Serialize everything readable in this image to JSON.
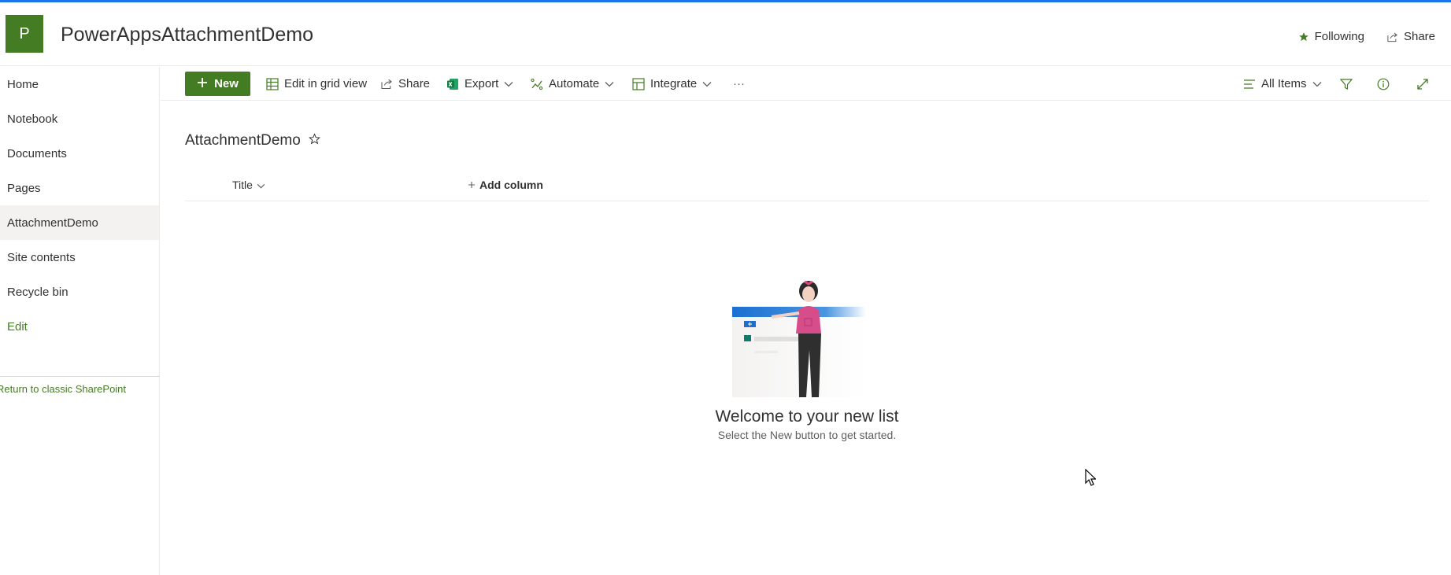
{
  "site": {
    "logo_letter": "P",
    "title": "PowerAppsAttachmentDemo",
    "following_label": "Following",
    "share_label": "Share"
  },
  "nav": {
    "items": [
      {
        "label": "Home"
      },
      {
        "label": "Notebook"
      },
      {
        "label": "Documents"
      },
      {
        "label": "Pages"
      },
      {
        "label": "AttachmentDemo",
        "selected": true
      },
      {
        "label": "Site contents"
      },
      {
        "label": "Recycle bin"
      },
      {
        "label": "Edit"
      }
    ],
    "classic_link": "Return to classic SharePoint"
  },
  "commands": {
    "new_label": "New",
    "grid_label": "Edit in grid view",
    "share_label": "Share",
    "export_label": "Export",
    "automate_label": "Automate",
    "integrate_label": "Integrate",
    "more_label": "···",
    "view_label": "All Items"
  },
  "list": {
    "title": "AttachmentDemo",
    "columns": [
      {
        "label": "Title"
      }
    ],
    "add_column_label": "Add column",
    "empty_title": "Welcome to your new list",
    "empty_subtitle": "Select the New button to get started."
  },
  "colors": {
    "accent_green": "#437c23",
    "top_bar_blue": "#1a73e8"
  }
}
